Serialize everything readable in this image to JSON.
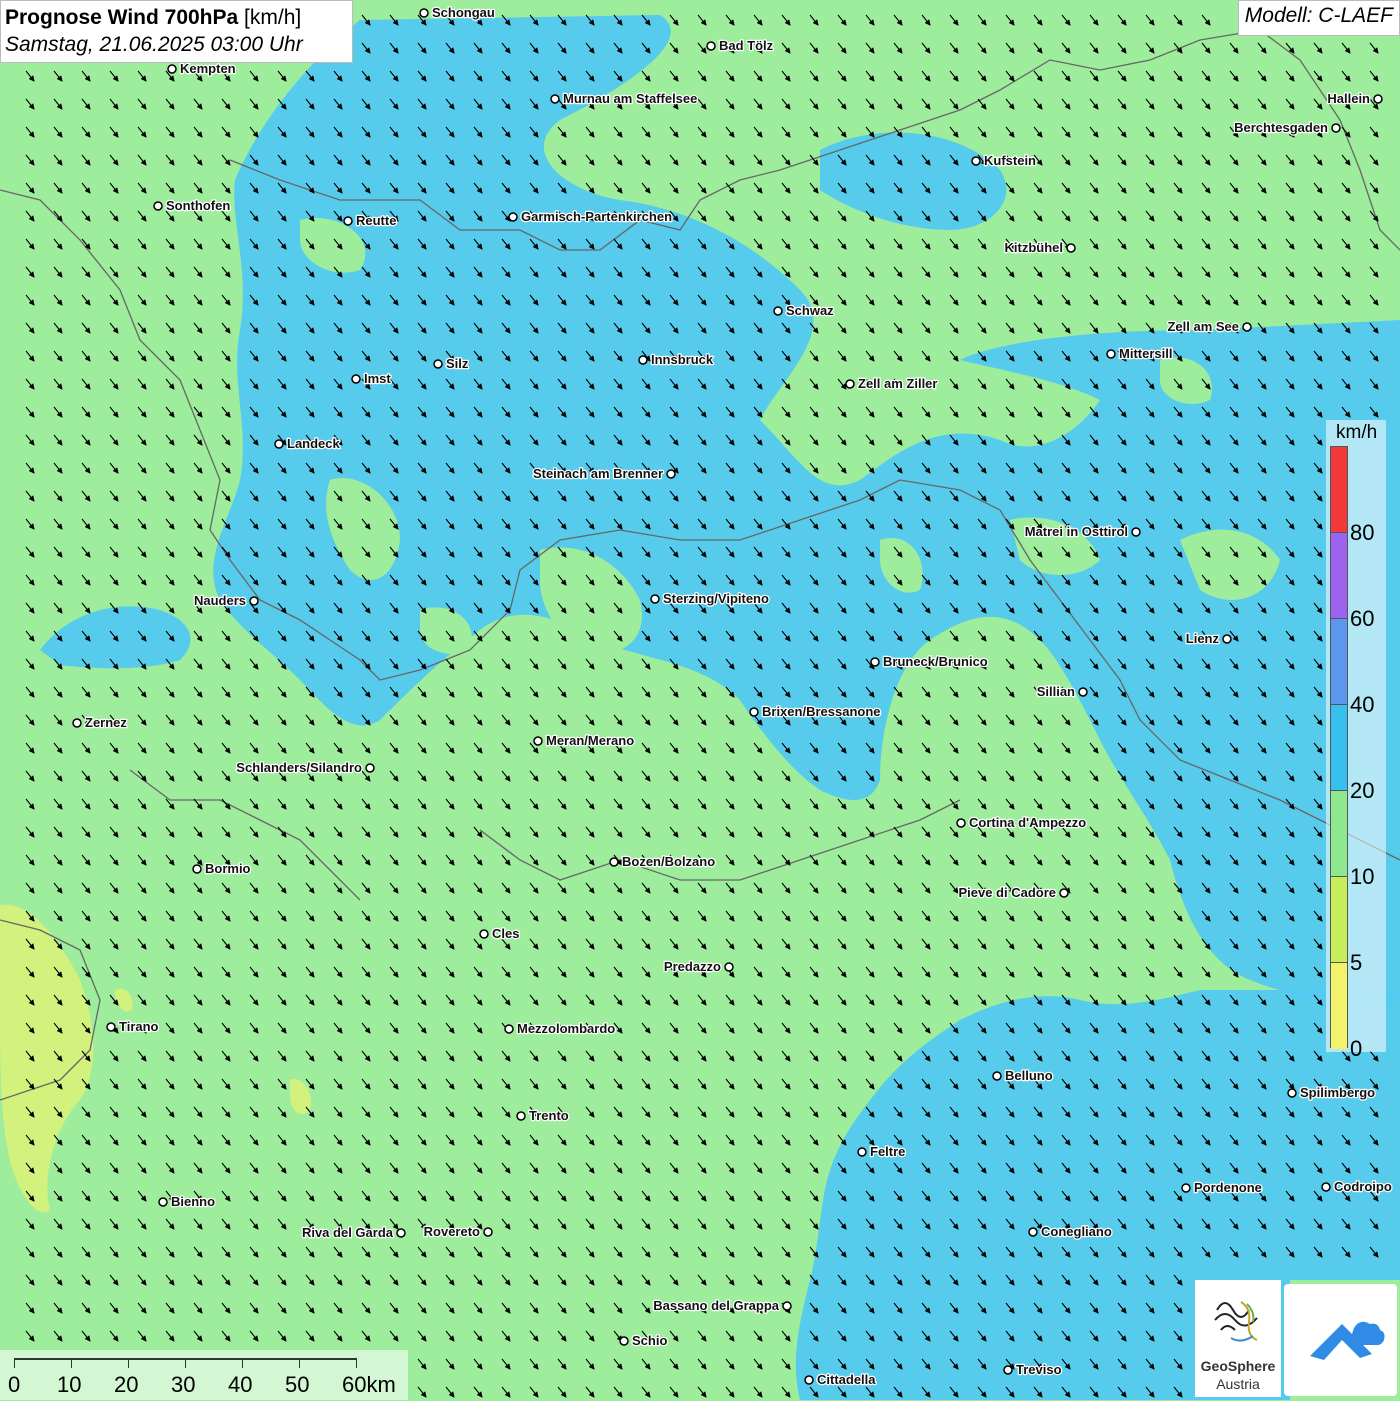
{
  "title": {
    "main_bold": "Prognose Wind 700hPa",
    "unit": "[km/h]",
    "datetime": "Samstag, 21.06.2025 03:00 Uhr"
  },
  "model": "Modell: C-LAEF",
  "colors": {
    "background": "#9ded9c",
    "blue_zone": "#53c9f0",
    "yellow_zone": "#d8f27a"
  },
  "legend": {
    "unit": "km/h",
    "levels": [
      {
        "label": "80",
        "color": "#f23a3a"
      },
      {
        "label": "60",
        "color": "#9b63ee"
      },
      {
        "label": "40",
        "color": "#5b97ef"
      },
      {
        "label": "20",
        "color": "#36c0ef"
      },
      {
        "label": "10",
        "color": "#8ee88e"
      },
      {
        "label": "5",
        "color": "#c6ee58"
      },
      {
        "label": "0",
        "color": "#f2f36b"
      }
    ],
    "top_color": "#f23a3a"
  },
  "scale": {
    "labels": [
      "0",
      "10",
      "20",
      "30",
      "40",
      "50",
      "60km"
    ]
  },
  "logos": {
    "geosphere_line1": "GeoSphere",
    "geosphere_line2": "Austria",
    "geosphere_icon": "geosphere-logo-icon",
    "app_icon": "weather-app-icon"
  },
  "cities": [
    {
      "name": "Schongau"
    },
    {
      "name": "Bad Tölz"
    },
    {
      "name": "Kempten"
    },
    {
      "name": "Murnau am Staffelsee"
    },
    {
      "name": "Hallein"
    },
    {
      "name": "Berchtesgaden"
    },
    {
      "name": "Kufstein"
    },
    {
      "name": "Sonthofen"
    },
    {
      "name": "Reutte"
    },
    {
      "name": "Garmisch-Partenkirchen"
    },
    {
      "name": "Kitzbühel"
    },
    {
      "name": "Schwaz"
    },
    {
      "name": "Zell am See"
    },
    {
      "name": "Mittersill"
    },
    {
      "name": "Innsbruck"
    },
    {
      "name": "Silz"
    },
    {
      "name": "Imst"
    },
    {
      "name": "Zell am Ziller"
    },
    {
      "name": "Landeck"
    },
    {
      "name": "Steinach am Brenner"
    },
    {
      "name": "Matrei in Osttirol"
    },
    {
      "name": "Nauders"
    },
    {
      "name": "Sterzing/Vipiteno"
    },
    {
      "name": "Lienz"
    },
    {
      "name": "Bruneck/Brunico"
    },
    {
      "name": "Sillian"
    },
    {
      "name": "Zernez"
    },
    {
      "name": "Brixen/Bressanone"
    },
    {
      "name": "Meran/Merano"
    },
    {
      "name": "Schlanders/Silandro"
    },
    {
      "name": "Cortina d'Ampezzo"
    },
    {
      "name": "Bozen/Bolzano"
    },
    {
      "name": "Bormio"
    },
    {
      "name": "Pieve di Cadore"
    },
    {
      "name": "Cles"
    },
    {
      "name": "Predazzo"
    },
    {
      "name": "Tirano"
    },
    {
      "name": "Mezzolombardo"
    },
    {
      "name": "Belluno"
    },
    {
      "name": "Spilimbergo"
    },
    {
      "name": "Trento"
    },
    {
      "name": "Feltre"
    },
    {
      "name": "Pordenone"
    },
    {
      "name": "Codroipo"
    },
    {
      "name": "Bienno"
    },
    {
      "name": "Riva del Garda"
    },
    {
      "name": "Rovereto"
    },
    {
      "name": "Conegliano"
    },
    {
      "name": "Bassano del Grappa"
    },
    {
      "name": "Schio"
    },
    {
      "name": "Treviso"
    },
    {
      "name": "Cittadella"
    }
  ]
}
